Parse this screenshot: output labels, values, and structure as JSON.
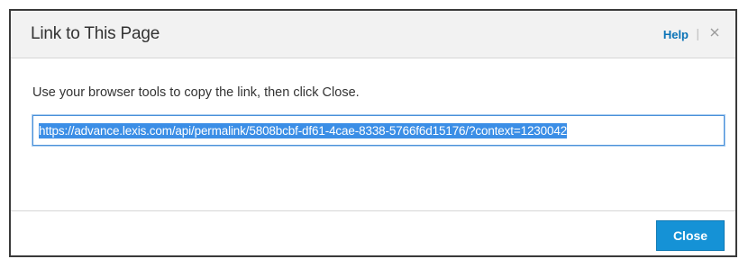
{
  "dialog": {
    "title": "Link to This Page",
    "help_label": "Help",
    "header_separator": "|",
    "instruction": "Use your browser tools to copy the link, then click Close.",
    "link_url": "https://advance.lexis.com/api/permalink/5808bcbf-df61-4cae-8338-5766f6d15176/?context=1230042",
    "close_label": "Close"
  },
  "icons": {
    "close": "close-icon"
  },
  "colors": {
    "accent": "#1592d6",
    "link": "#0a73b7",
    "selection": "#3b8ee6",
    "header_bg": "#f2f2f2"
  }
}
